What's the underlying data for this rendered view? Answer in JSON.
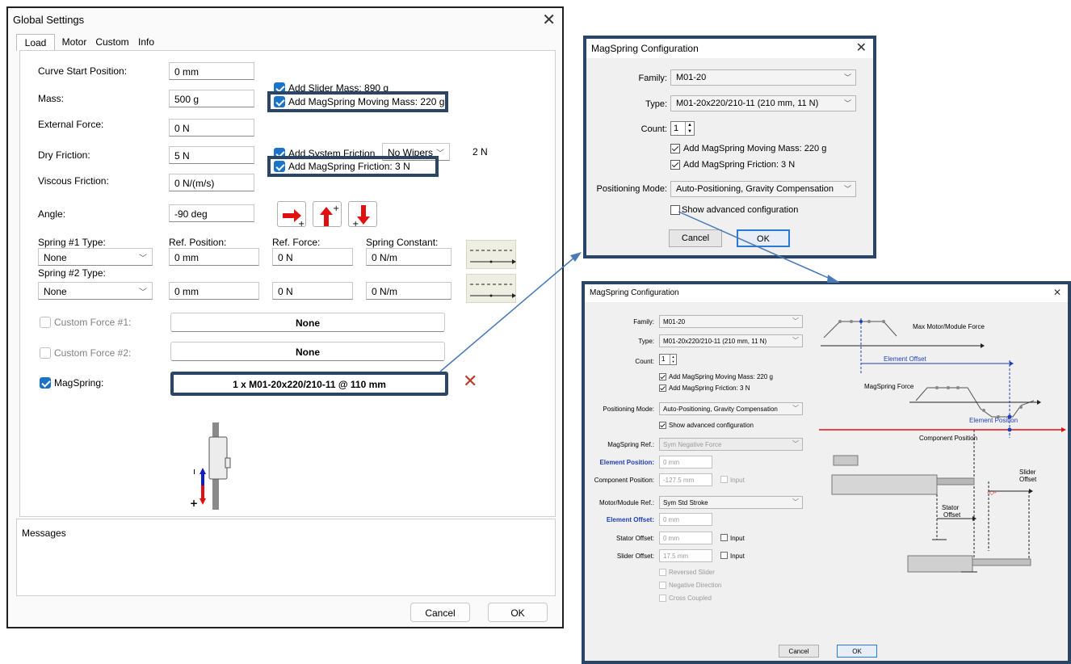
{
  "global_settings": {
    "title": "Global Settings",
    "tabs": [
      "Load",
      "Motor",
      "Custom",
      "Info"
    ],
    "load": {
      "curve_start_label": "Curve Start Position:",
      "curve_start_value": "0 mm",
      "mass_label": "Mass:",
      "mass_value": "500 g",
      "add_slider_mass": "Add Slider Mass: 890 g",
      "add_magspring_moving_mass": "Add MagSpring Moving Mass: 220 g",
      "external_force_label": "External Force:",
      "external_force_value": "0 N",
      "dry_friction_label": "Dry Friction:",
      "dry_friction_value": "5 N",
      "add_system_friction": "Add System Friction",
      "wipers_value": "No Wipers",
      "system_friction_value": "2 N",
      "add_magspring_friction": "Add MagSpring Friction: 3 N",
      "viscous_friction_label": "Viscous Friction:",
      "viscous_friction_value": "0 N/(m/s)",
      "angle_label": "Angle:",
      "angle_value": "-90 deg",
      "spring1_type_label": "Spring #1 Type:",
      "ref_position_label": "Ref. Position:",
      "ref_force_label": "Ref. Force:",
      "spring_constant_label": "Spring Constant:",
      "spring1_type": "None",
      "spring1_ref_position": "0 mm",
      "spring1_ref_force": "0 N",
      "spring1_constant": "0 N/m",
      "spring2_type_label": "Spring #2 Type:",
      "spring2_type": "None",
      "spring2_ref_position": "0 mm",
      "spring2_ref_force": "0 N",
      "spring2_constant": "0 N/m",
      "custom_force1_label": "Custom Force #1:",
      "custom_force1_value": "None",
      "custom_force2_label": "Custom Force #2:",
      "custom_force2_value": "None",
      "magspring_label": "MagSpring:",
      "magspring_value": "1 x M01-20x220/210-11 @ 110 mm"
    },
    "messages_label": "Messages",
    "cancel": "Cancel",
    "ok": "OK"
  },
  "magspring_small": {
    "title": "MagSpring Configuration",
    "family_label": "Family:",
    "family_value": "M01-20",
    "type_label": "Type:",
    "type_value": "M01-20x220/210-11 (210 mm, 11 N)",
    "count_label": "Count:",
    "count_value": "1",
    "add_moving_mass": "Add MagSpring Moving Mass: 220 g",
    "add_friction": "Add MagSpring Friction: 3 N",
    "positioning_mode_label": "Positioning Mode:",
    "positioning_mode_value": "Auto-Positioning, Gravity Compensation",
    "show_advanced": "Show advanced configuration",
    "cancel": "Cancel",
    "ok": "OK"
  },
  "magspring_big": {
    "title": "MagSpring Configuration",
    "family_label": "Family:",
    "family_value": "M01-20",
    "type_label": "Type:",
    "type_value": "M01-20x220/210-11 (210 mm, 11 N)",
    "count_label": "Count:",
    "count_value": "1",
    "add_moving_mass": "Add MagSpring Moving Mass: 220 g",
    "add_friction": "Add MagSpring Friction: 3 N",
    "positioning_mode_label": "Positioning Mode:",
    "positioning_mode_value": "Auto-Positioning, Gravity Compensation",
    "show_advanced": "Show advanced configuration",
    "magspring_ref_label": "MagSpring Ref.:",
    "magspring_ref_value": "Sym Negative Force",
    "element_position_label": "Element Position:",
    "element_position_value": "0 mm",
    "component_position_label": "Component Position:",
    "component_position_value": "-127.5 mm",
    "input_label": "Input",
    "motor_ref_label": "Motor/Module Ref.:",
    "motor_ref_value": "Sym Std Stroke",
    "element_offset_label": "Element Offset:",
    "element_offset_value": "0 mm",
    "stator_offset_label": "Stator Offset:",
    "stator_offset_value": "0 mm",
    "slider_offset_label": "Slider Offset:",
    "slider_offset_value": "17.5 mm",
    "reversed_slider": "Reversed Slider",
    "negative_direction": "Negative Direction",
    "cross_coupled": "Cross Coupled",
    "cancel": "Cancel",
    "ok": "OK",
    "diagram": {
      "max_force": "Max Motor/Module Force",
      "element_offset": "Element Offset",
      "magspring_force": "MagSpring Force",
      "element_position": "Element Position",
      "component_position": "Component Position",
      "stator": "Stator",
      "stator_offset_line2": "Offset",
      "slider": "Slider",
      "slider_offset_line2": "Offset"
    }
  },
  "colors": {
    "highlight": "#2b4567",
    "checkbox_blue": "#1a73c8",
    "arrow_red": "#e01010",
    "connector": "#4a79b8"
  }
}
